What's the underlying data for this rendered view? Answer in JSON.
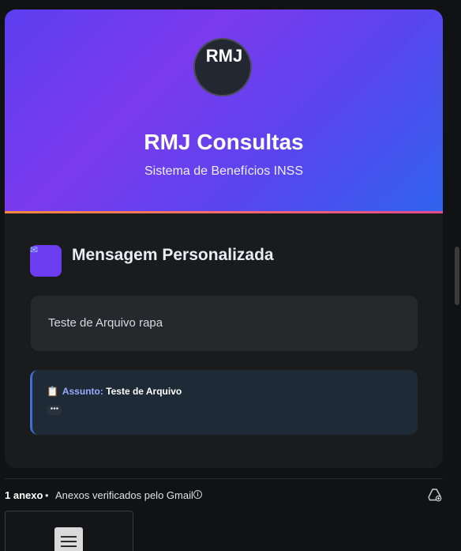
{
  "email": {
    "header": {
      "avatar_text": "RMJ",
      "title": "RMJ Consultas",
      "subtitle": "Sistema de Benefícios INSS"
    },
    "section": {
      "icon": "sparkle-icon",
      "icon_glyph": "✉",
      "title": "Mensagem Personalizada"
    },
    "message": {
      "text": "Teste de Arquivo rapa"
    },
    "subject": {
      "icon": "clipboard-icon",
      "icon_glyph": "📋",
      "label": "Assunto:",
      "value": "Teste de Arquivo",
      "more_label": "•••"
    }
  },
  "attachments": {
    "count_label": "1 anexo",
    "separator": "•",
    "verified_label": "Anexos verificados pelo Gmail",
    "info_glyph": "i",
    "drive_icon": "add-to-drive-icon",
    "file_icon": "document-icon"
  },
  "colors": {
    "accent": "#7b3aed",
    "hero_gradient_end": "#2f63ee",
    "subject_label": "#9aa8ff"
  }
}
